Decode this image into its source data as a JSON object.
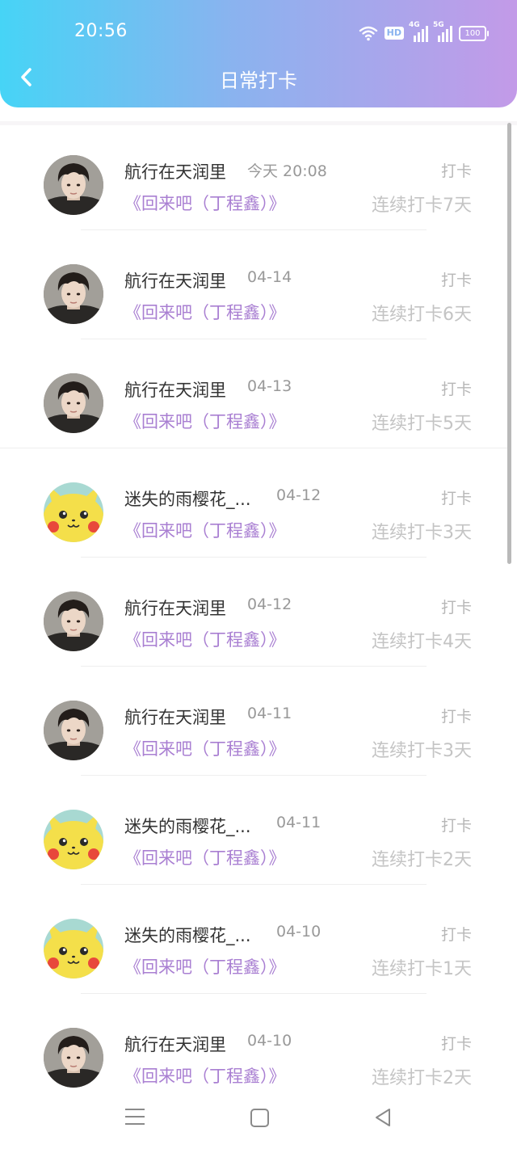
{
  "status": {
    "time": "20:56",
    "hd": "HD",
    "net1": "4G",
    "net2": "5G",
    "battery": "100"
  },
  "header": {
    "title": "日常打卡"
  },
  "rows": [
    {
      "name": "航行在天润里",
      "date": "今天 20:08",
      "song": "《回来吧（丁程鑫）》",
      "tag": "打卡",
      "streak": "连续打卡7天",
      "avatar": "portrait-avatar"
    },
    {
      "name": "航行在天润里",
      "date": "04-14",
      "song": "《回来吧（丁程鑫）》",
      "tag": "打卡",
      "streak": "连续打卡6天",
      "avatar": "portrait-avatar"
    },
    {
      "name": "航行在天润里",
      "date": "04-13",
      "song": "《回来吧（丁程鑫）》",
      "tag": "打卡",
      "streak": "连续打卡5天",
      "avatar": "portrait-avatar"
    },
    {
      "name": "迷失的雨樱花_...",
      "date": "04-12",
      "song": "《回来吧（丁程鑫）》",
      "tag": "打卡",
      "streak": "连续打卡3天",
      "avatar": "pikachu-avatar"
    },
    {
      "name": "航行在天润里",
      "date": "04-12",
      "song": "《回来吧（丁程鑫）》",
      "tag": "打卡",
      "streak": "连续打卡4天",
      "avatar": "portrait-avatar"
    },
    {
      "name": "航行在天润里",
      "date": "04-11",
      "song": "《回来吧（丁程鑫）》",
      "tag": "打卡",
      "streak": "连续打卡3天",
      "avatar": "portrait-avatar"
    },
    {
      "name": "迷失的雨樱花_...",
      "date": "04-11",
      "song": "《回来吧（丁程鑫）》",
      "tag": "打卡",
      "streak": "连续打卡2天",
      "avatar": "pikachu-avatar"
    },
    {
      "name": "迷失的雨樱花_...",
      "date": "04-10",
      "song": "《回来吧（丁程鑫）》",
      "tag": "打卡",
      "streak": "连续打卡1天",
      "avatar": "pikachu-avatar"
    },
    {
      "name": "航行在天润里",
      "date": "04-10",
      "song": "《回来吧（丁程鑫）》",
      "tag": "打卡",
      "streak": "连续打卡2天",
      "avatar": "portrait-avatar"
    }
  ],
  "colors": {
    "header_start": "#46d4f6",
    "header_end": "#c39ae8",
    "song": "#a97fd2",
    "muted": "#c4c4c4"
  },
  "icons": {
    "back": "chevron-left-icon",
    "menu": "menu-icon",
    "home": "home-icon",
    "nav_back": "triangle-back-icon"
  }
}
